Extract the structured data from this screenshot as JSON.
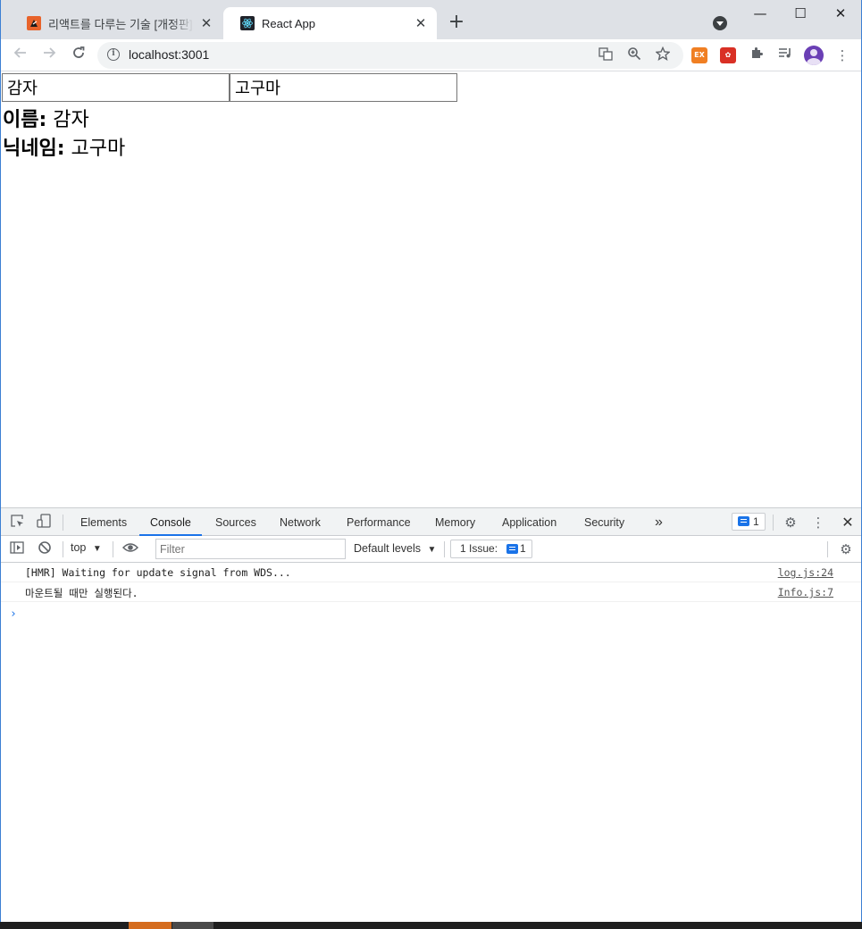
{
  "browser": {
    "tabs": [
      {
        "title": "리액트를 다루는 기술 [개정판]: (",
        "favicon": "book-favicon",
        "active": false
      },
      {
        "title": "React App",
        "favicon": "react-favicon",
        "active": true
      }
    ],
    "close_glyph": "✕",
    "new_tab_glyph": "+",
    "window": {
      "minimize": "—",
      "maximize": "☐",
      "close": "✕"
    },
    "url": "localhost:3001",
    "extensions": [
      {
        "name": "ex-extension-icon",
        "label": "EX",
        "color": "#f07f23"
      },
      {
        "name": "red-extension-icon",
        "label": "✿",
        "color": "#d93025"
      }
    ]
  },
  "page": {
    "name_input_value": "감자",
    "nickname_input_value": "고구마",
    "name_label": "이름:",
    "name_value": "감자",
    "nickname_label": "닉네임:",
    "nickname_value": "고구마"
  },
  "devtools": {
    "tabs": [
      "Elements",
      "Console",
      "Sources",
      "Network",
      "Performance",
      "Memory",
      "Application",
      "Security"
    ],
    "active_tab": "Console",
    "more_tabs": "»",
    "issue_badge_count": "1",
    "context": "top",
    "filter_placeholder": "Filter",
    "levels": "Default levels",
    "issues_label": "1 Issue:",
    "issues_count": "1",
    "messages": [
      {
        "text": "[HMR] Waiting for update signal from WDS...",
        "source": "log.js:24"
      },
      {
        "text": "마운트될 때만 실행된다.",
        "source": "Info.js:7"
      }
    ],
    "prompt": "›"
  }
}
